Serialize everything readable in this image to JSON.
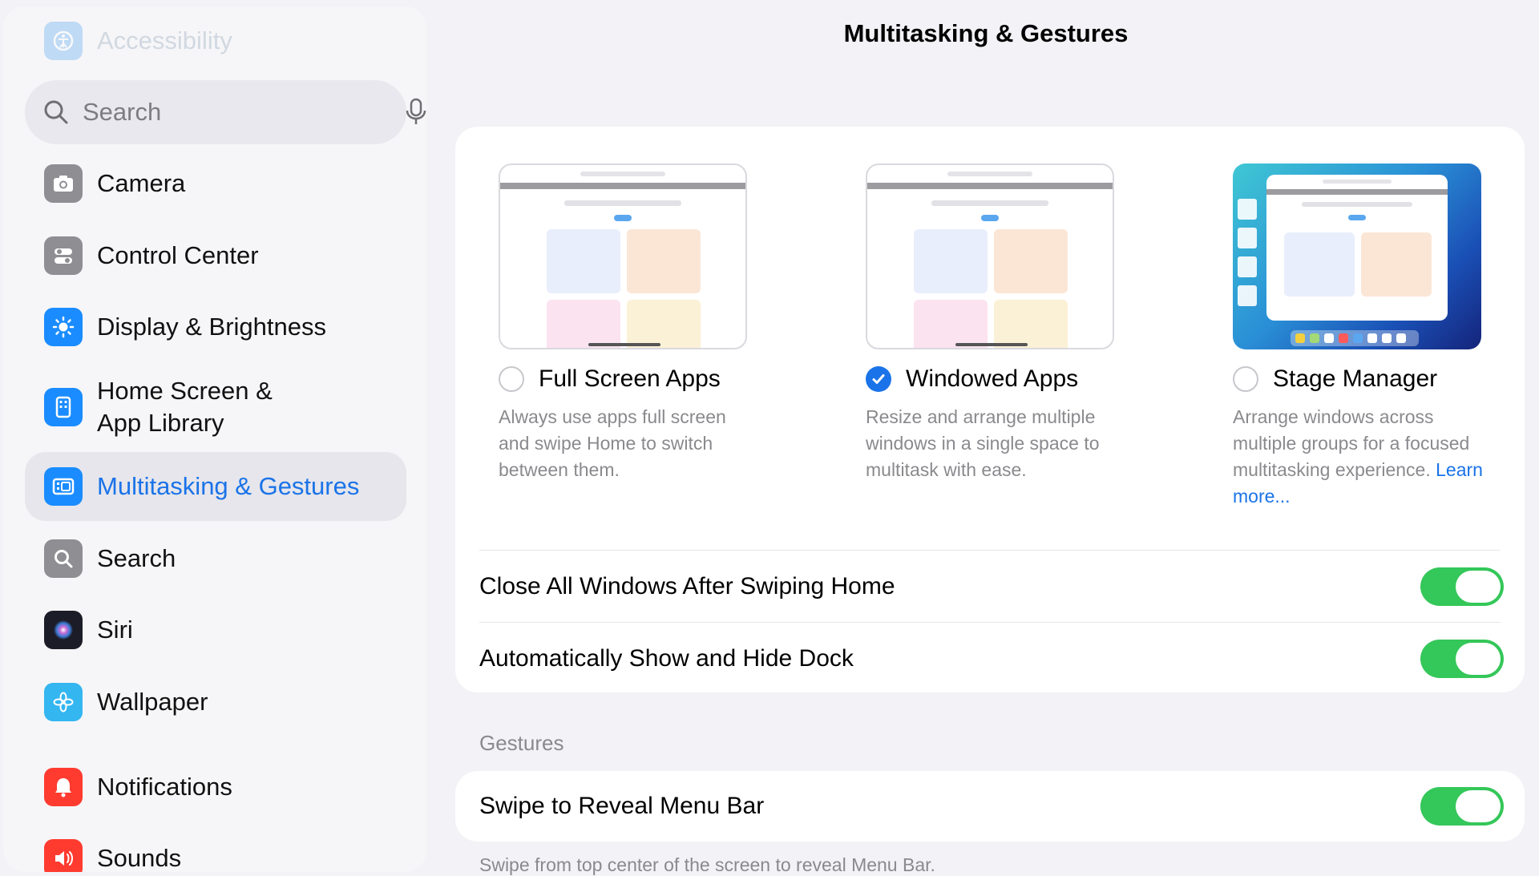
{
  "page": {
    "title": "Multitasking & Gestures"
  },
  "sidebar": {
    "top_item": {
      "label": "Accessibility",
      "icon": "accessibility-icon",
      "color": "#5aa7f0"
    },
    "search": {
      "placeholder": "Search"
    },
    "items": [
      {
        "label": "Camera",
        "icon": "camera-icon",
        "color": "#8e8e93"
      },
      {
        "label": "Control Center",
        "icon": "control-center-icon",
        "color": "#8e8e93"
      },
      {
        "label": "Display & Brightness",
        "icon": "display-brightness-icon",
        "color": "#1a8cff"
      },
      {
        "label": "Home Screen & App Library",
        "icon": "home-screen-icon",
        "color": "#1a8cff"
      },
      {
        "label": "Multitasking & Gestures",
        "icon": "multitasking-icon",
        "color": "#1a8cff",
        "selected": true
      },
      {
        "label": "Search",
        "icon": "search-app-icon",
        "color": "#8e8e93"
      },
      {
        "label": "Siri",
        "icon": "siri-icon",
        "color": "#222"
      },
      {
        "label": "Wallpaper",
        "icon": "wallpaper-icon",
        "color": "#34b6f0"
      },
      {
        "label": "Notifications",
        "icon": "notifications-icon",
        "color": "#ff3b30"
      },
      {
        "label": "Sounds",
        "icon": "sounds-icon",
        "color": "#ff3b30"
      }
    ]
  },
  "modes": [
    {
      "title": "Full Screen Apps",
      "selected": false,
      "description": "Always use apps full screen and swipe Home to switch between them."
    },
    {
      "title": "Windowed Apps",
      "selected": true,
      "description": "Resize and arrange multiple windows in a single space to multitask with ease."
    },
    {
      "title": "Stage Manager",
      "selected": false,
      "description": "Arrange windows across multiple groups for a focused multitasking experience.",
      "link": "Learn more..."
    }
  ],
  "settings": [
    {
      "label": "Close All Windows After Swiping Home",
      "on": true
    },
    {
      "label": "Automatically Show and Hide Dock",
      "on": true
    }
  ],
  "gestures": {
    "header": "Gestures",
    "items": [
      {
        "label": "Swipe to Reveal Menu Bar",
        "on": true
      }
    ],
    "footnote": "Swipe from top center of the screen to reveal Menu Bar."
  },
  "colors": {
    "accent": "#1a73e8",
    "toggle_on": "#34c759"
  }
}
